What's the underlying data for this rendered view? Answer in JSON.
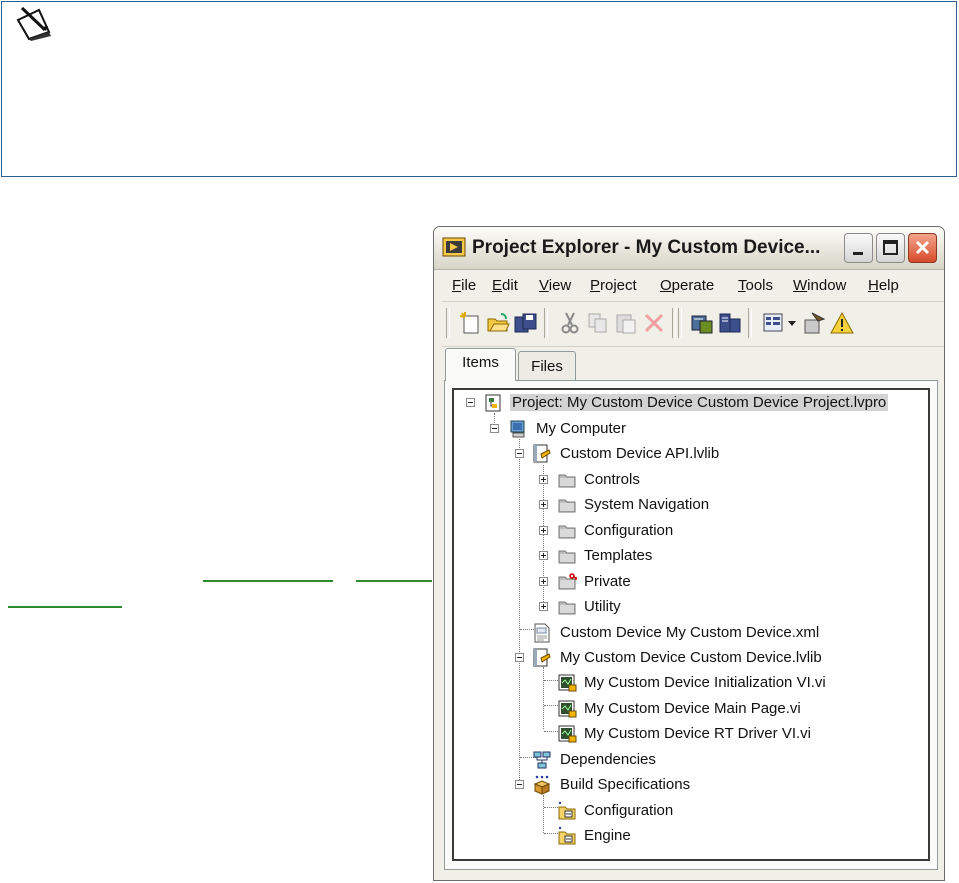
{
  "window": {
    "title": "Project Explorer - My Custom Device...",
    "menu": [
      {
        "label": "File",
        "u": "F",
        "rest": "ile"
      },
      {
        "label": "Edit",
        "u": "E",
        "rest": "dit"
      },
      {
        "label": "View",
        "u": "V",
        "rest": "iew"
      },
      {
        "label": "Project",
        "u": "P",
        "rest": "roject"
      },
      {
        "label": "Operate",
        "u": "O",
        "rest": "perate"
      },
      {
        "label": "Tools",
        "u": "T",
        "rest": "ools"
      },
      {
        "label": "Window",
        "u": "W",
        "rest": "indow"
      },
      {
        "label": "Help",
        "u": "H",
        "rest": "elp"
      }
    ],
    "tabs": {
      "items": "Items",
      "files": "Files"
    }
  },
  "tree": [
    {
      "label": "Project: My Custom Device Custom Device Project.lvpro",
      "icon": "project-icon"
    },
    {
      "label": "My Computer",
      "icon": "computer-icon"
    },
    {
      "label": "Custom Device API.lvlib",
      "icon": "library-icon"
    },
    {
      "label": "Controls",
      "icon": "folder-icon"
    },
    {
      "label": "System Navigation",
      "icon": "folder-icon"
    },
    {
      "label": "Configuration",
      "icon": "folder-icon"
    },
    {
      "label": "Templates",
      "icon": "folder-icon"
    },
    {
      "label": "Private",
      "icon": "private-folder-icon"
    },
    {
      "label": "Utility",
      "icon": "folder-icon"
    },
    {
      "label": "Custom Device My Custom Device.xml",
      "icon": "xml-file-icon"
    },
    {
      "label": "My Custom Device Custom Device.lvlib",
      "icon": "library-icon"
    },
    {
      "label": "My Custom Device Initialization VI.vi",
      "icon": "vi-icon"
    },
    {
      "label": "My Custom Device Main Page.vi",
      "icon": "vi-icon"
    },
    {
      "label": "My Custom Device RT Driver VI.vi",
      "icon": "vi-icon"
    },
    {
      "label": "Dependencies",
      "icon": "dependencies-icon"
    },
    {
      "label": "Build Specifications",
      "icon": "build-specifications-icon"
    },
    {
      "label": "Configuration",
      "icon": "build-spec-item-icon"
    },
    {
      "label": "Engine",
      "icon": "build-spec-item-icon"
    }
  ],
  "colors": {
    "note_border": "#2f5f8f",
    "link": "#2d8a2d",
    "selection": "#d3d3d3"
  }
}
